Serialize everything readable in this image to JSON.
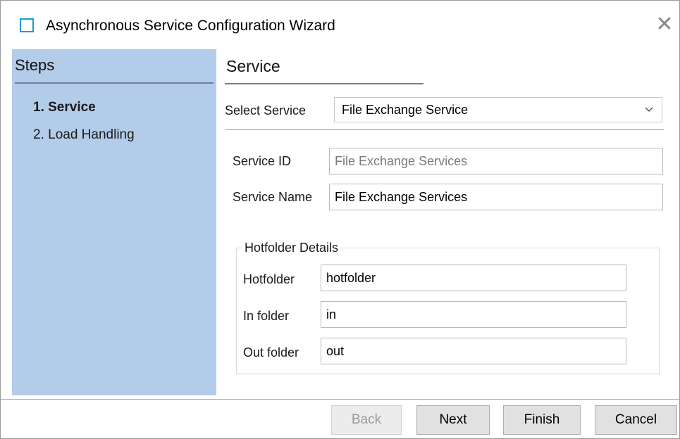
{
  "window": {
    "title": "Asynchronous Service Configuration Wizard",
    "close_glyph": "✕",
    "accent_color": "#1b9ad6"
  },
  "steps": {
    "heading": "Steps",
    "items": [
      {
        "label": "1. Service",
        "active": true
      },
      {
        "label": "2. Load Handling",
        "active": false
      }
    ],
    "panel_color": "#b3cce9"
  },
  "service": {
    "title": "Service",
    "select_label": "Select Service",
    "select_value": "File Exchange Service",
    "service_id_label": "Service ID",
    "service_id_value": "File Exchange Services",
    "service_name_label": "Service Name",
    "service_name_value": "File Exchange Services"
  },
  "hotfolder": {
    "legend": "Hotfolder Details",
    "hotfolder_label": "Hotfolder",
    "hotfolder_value": "hotfolder",
    "in_label": "In folder",
    "in_value": "in",
    "out_label": "Out folder",
    "out_value": "out"
  },
  "footer": {
    "back": "Back",
    "next": "Next",
    "finish": "Finish",
    "cancel": "Cancel"
  }
}
